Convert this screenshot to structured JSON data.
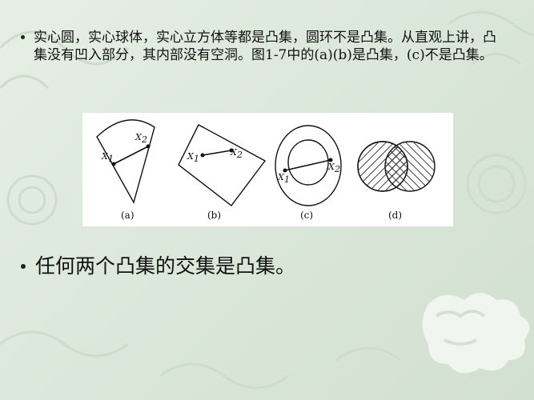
{
  "bullets": {
    "first": "实心圆，实心球体，实心立方体等都是凸集，圆环不是凸集。从直观上讲，凸集没有凹入部分，其内部没有空洞。图1-7中的(a)(b)是凸集，(c)不是凸集。",
    "second": "任何两个凸集的交集是凸集。"
  },
  "figure": {
    "captions": {
      "a": "(a)",
      "b": "(b)",
      "c": "(c)",
      "d": "(d)"
    },
    "labels": {
      "x1": "X",
      "x2": "X",
      "sub1": "1",
      "sub2": "2"
    }
  },
  "colors": {
    "background": "#dde8dc",
    "pattern": "#c9d9c8",
    "figure_bg": "#ffffff",
    "ink": "#111111"
  }
}
